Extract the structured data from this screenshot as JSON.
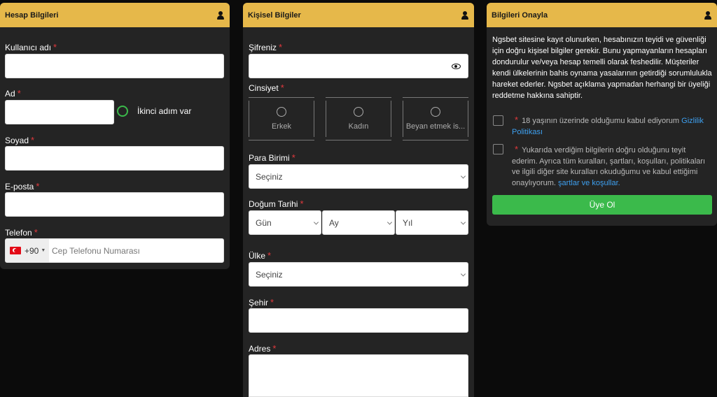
{
  "account": {
    "title": "Hesap Bilgileri",
    "username_label": "Kullanıcı adı",
    "name_label": "Ad",
    "second_step": "İkinci adım var",
    "surname_label": "Soyad",
    "email_label": "E-posta",
    "phone_label": "Telefon",
    "phone_code": "+90",
    "phone_placeholder": "Cep Telefonu Numarası"
  },
  "personal": {
    "title": "Kişisel Bilgiler",
    "password_label": "Şifreniz",
    "gender_label": "Cinsiyet",
    "genders": [
      "Erkek",
      "Kadın",
      "Beyan etmek is..."
    ],
    "currency_label": "Para Birimi",
    "currency_value": "Seçiniz",
    "birth_label": "Doğum Tarihi",
    "day": "Gün",
    "month": "Ay",
    "year": "Yıl",
    "country_label": "Ülke",
    "country_value": "Seçiniz",
    "city_label": "Şehir",
    "address_label": "Adres"
  },
  "confirm": {
    "title": "Bilgileri Onayla",
    "text": "Ngsbet sitesine kayıt olunurken, hesabınızın teyidi ve güvenliği için doğru kişisel bilgiler gerekir. Bunu yapmayanların hesapları dondurulur ve/veya hesap temelli olarak feshedilir. Müşteriler kendi ülkelerinin bahis oynama yasalarının getirdiği sorumlulukla hareket ederler. Ngsbet açıklama yapmadan herhangi bir üyeliği reddetme hakkına sahiptir.",
    "age_text": "18 yaşının üzerinde olduğumu kabul ediyorum",
    "age_link": "Gizlilik Politikası",
    "terms_text": "Yukarıda verdiğim bilgilerin doğru olduğunu teyit ederim. Ayrıca tüm kuralları, şartları, koşulları, politikaları ve ilgili diğer site kuralları okuduğumu ve kabul ettiğimi onaylıyorum.",
    "terms_link": "şartlar ve koşullar.",
    "button": "Üye Ol",
    "required_mark": "*"
  },
  "colors": {
    "header": "#e6b84a",
    "button": "#3bba4b",
    "link": "#3ea0f0",
    "required": "#e2393d"
  }
}
